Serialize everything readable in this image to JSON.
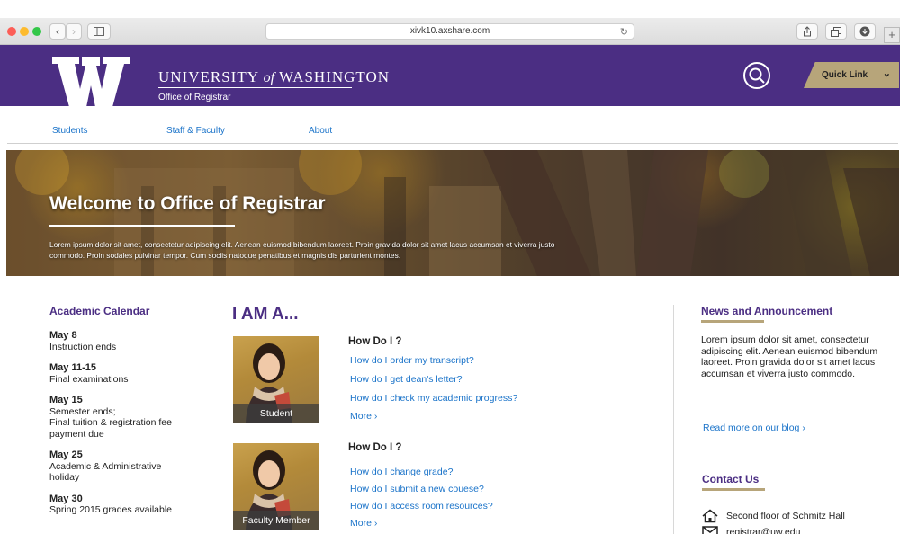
{
  "browser": {
    "url": "xivk10.axshare.com",
    "icons": [
      "back-icon",
      "forward-icon",
      "sidebar-icon",
      "reload-icon",
      "share-icon",
      "tabs-icon",
      "download-icon",
      "new-tab-icon"
    ]
  },
  "header": {
    "university": "UNIVERSITY",
    "of": "of",
    "washington": "WASHINGTON",
    "office": "Office of Registrar",
    "quick_link": "Quick Link",
    "brand_color": "#4b2e83",
    "gold_color": "#b7a57a"
  },
  "nav": {
    "items": [
      {
        "label": "Students"
      },
      {
        "label": "Staff & Faculty"
      },
      {
        "label": "About"
      }
    ]
  },
  "hero": {
    "title": "Welcome to Office of Registrar",
    "text": "Lorem ipsum dolor sit amet, consectetur adipiscing elit. Aenean euismod bibendum laoreet. Proin gravida dolor sit amet lacus accumsan et viverra justo commodo. Proin sodales pulvinar tempor. Cum sociis natoque penatibus et magnis dis parturient montes."
  },
  "calendar": {
    "title": "Academic Calendar",
    "items": [
      {
        "date": "May 8",
        "lines": [
          "Instruction ends"
        ]
      },
      {
        "date": "May 11-15",
        "lines": [
          "Final examinations"
        ]
      },
      {
        "date": "May 15",
        "lines": [
          "Semester ends;",
          "Final tuition & registration fee payment due"
        ]
      },
      {
        "date": "May 25",
        "lines": [
          "Academic & Administrative holiday"
        ]
      },
      {
        "date": "May 30",
        "lines": [
          "Spring 2015 grades available"
        ]
      }
    ]
  },
  "main": {
    "title": "I AM A...",
    "roles": [
      {
        "caption": "Student",
        "heading": "How Do I ?",
        "links": [
          "How do I order my transcript?",
          "How do I get dean's letter?",
          "How do I check my academic progress?"
        ],
        "more": "More ›"
      },
      {
        "caption": "Faculty Member",
        "heading": "How Do I ?",
        "links": [
          "How do I change grade?",
          "How do I submit a new couese?",
          "How do I access room resources?"
        ],
        "more": "More ›"
      }
    ]
  },
  "news": {
    "title": "News and Announcement",
    "text": "Lorem ipsum dolor sit amet, consectetur adipiscing elit. Aenean euismod bibendum laoreet. Proin gravida dolor sit amet lacus accumsan et viverra justo commodo.",
    "blog_link": "Read more on our blog ›"
  },
  "contact": {
    "title": "Contact Us",
    "address": "Second floor of Schmitz Hall",
    "email": "registrar@uw.edu"
  }
}
